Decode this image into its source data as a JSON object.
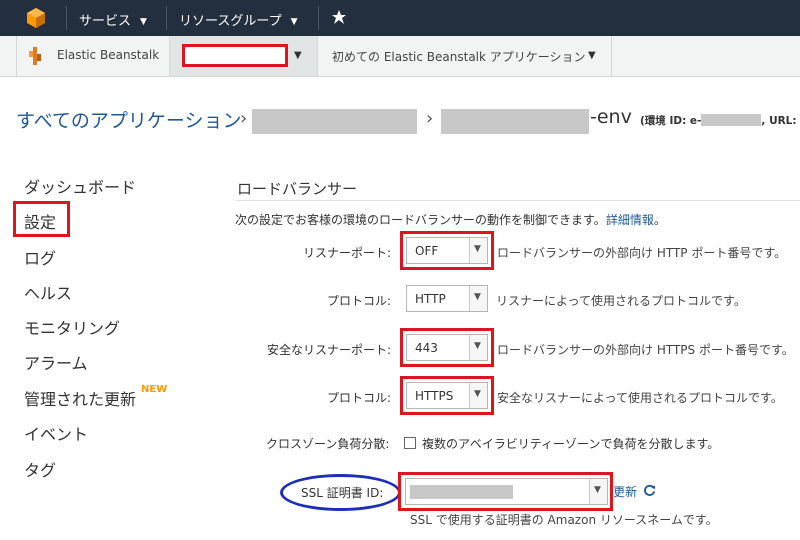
{
  "topnav": {
    "services_label": "サービス",
    "resource_groups_label": "リソースグループ"
  },
  "svcbar": {
    "service_name": "Elastic Beanstalk",
    "first_app_label": "初めての Elastic Beanstalk アプリケーション"
  },
  "breadcrumb": {
    "root": "すべてのアプリケーション",
    "env_suffix": "-env",
    "env_meta": "(環境 ID: e-",
    "url_label": ", URL: a"
  },
  "sidebar": {
    "items": [
      {
        "label": "ダッシュボード"
      },
      {
        "label": "設定"
      },
      {
        "label": "ログ"
      },
      {
        "label": "ヘルス"
      },
      {
        "label": "モニタリング"
      },
      {
        "label": "アラーム"
      },
      {
        "label": "管理された更新"
      },
      {
        "label": "イベント"
      },
      {
        "label": "タグ"
      }
    ],
    "new_badge": "NEW",
    "active_index": 1
  },
  "load_balancer": {
    "title": "ロードバランサー",
    "description": "次の設定でお客様の環境のロードバランサーの動作を制御できます。",
    "details_link": "詳細情報",
    "details_suffix": "。",
    "rows": {
      "listener_port": {
        "label": "リスナーポート:",
        "value": "OFF",
        "hint": "ロードバランサーの外部向け HTTP ポート番号です。"
      },
      "protocol": {
        "label": "プロトコル:",
        "value": "HTTP",
        "hint": "リスナーによって使用されるプロトコルです。"
      },
      "secure_listener_port": {
        "label": "安全なリスナーポート:",
        "value": "443",
        "hint": "ロードバランサーの外部向け HTTPS ポート番号です。"
      },
      "secure_protocol": {
        "label": "プロトコル:",
        "value": "HTTPS",
        "hint": "安全なリスナーによって使用されるプロトコルです。"
      },
      "cross_zone": {
        "label": "クロスゾーン負荷分散:",
        "checkbox_text": "複数のアベイラビリティーゾーンで負荷を分散します。",
        "checked": false
      },
      "ssl_cert": {
        "label": "SSL 証明書 ID:",
        "value": "",
        "refresh_label": "更新",
        "hint": "SSL で使用する証明書の Amazon リソースネームです。"
      }
    }
  },
  "colors": {
    "navbar": "#232f3e",
    "highlight_red": "#e0141e",
    "highlight_blue": "#1d2fb6",
    "link": "#1f5a96",
    "new_badge": "#ff9900"
  }
}
